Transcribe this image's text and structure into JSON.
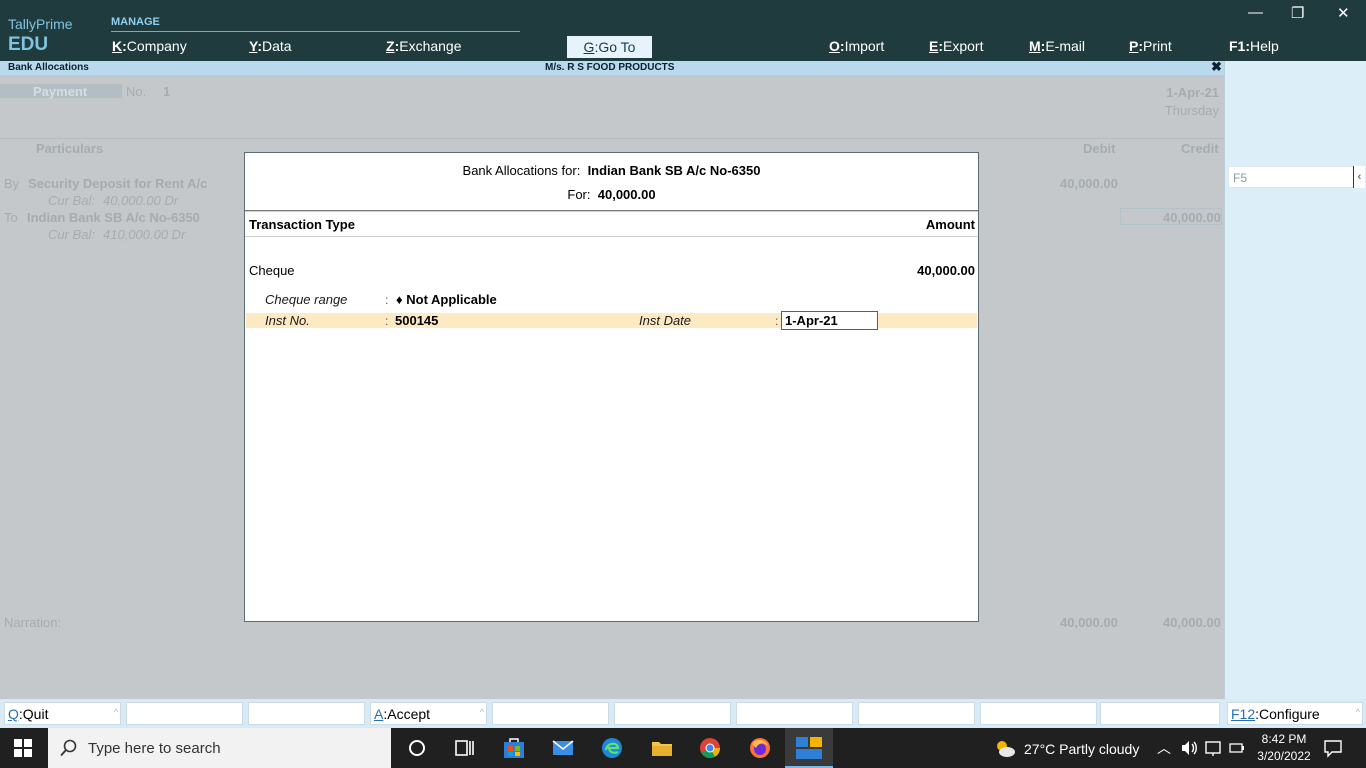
{
  "app": {
    "brand_line1": "TallyPrime",
    "brand_line2": "EDU",
    "manage_label": "MANAGE"
  },
  "menu": {
    "company": {
      "key": "K",
      "label": "Company"
    },
    "data": {
      "key": "Y",
      "label": "Data"
    },
    "exchange": {
      "key": "Z",
      "label": "Exchange"
    },
    "goto": {
      "key": "G",
      "label": "Go To"
    },
    "import": {
      "key": "O",
      "label": "Import"
    },
    "export": {
      "key": "E",
      "label": "Export"
    },
    "email": {
      "key": "M",
      "label": "E-mail"
    },
    "print": {
      "key": "P",
      "label": "Print"
    },
    "help": {
      "key": "F1",
      "label": "Help"
    }
  },
  "window_controls": {
    "minimize": "—",
    "restore": "❐",
    "close": "✕"
  },
  "subbar": {
    "title": "Bank Allocations",
    "company": "M/s. R S FOOD PRODUCTS",
    "close": "✖"
  },
  "voucher": {
    "type": "Payment",
    "no_label": "No.",
    "no_value": "1",
    "date": "1-Apr-21",
    "day": "Thursday",
    "col_particulars": "Particulars",
    "col_debit": "Debit",
    "col_credit": "Credit",
    "row1": {
      "prefix": "By",
      "ledger": "Security Deposit for Rent A/c",
      "cur_bal_label": "Cur Bal:",
      "cur_bal": "40,000.00 Dr",
      "debit": "40,000.00"
    },
    "row2": {
      "prefix": "To",
      "ledger": "Indian Bank SB A/c No-6350",
      "cur_bal_label": "Cur Bal:",
      "cur_bal": "410,000.00 Dr",
      "credit": "40,000.00"
    },
    "narration_label": "Narration:",
    "total_debit": "40,000.00",
    "total_credit": "40,000.00"
  },
  "right_panel": {
    "f5_placeholder": "F5",
    "arrow": "‹"
  },
  "dialog": {
    "title_prefix": "Bank Allocations for:",
    "title_ledger": "Indian Bank SB A/c No-6350",
    "for_label": "For:",
    "for_amount": "40,000.00",
    "col_type": "Transaction Type",
    "col_amount": "Amount",
    "txn_type": "Cheque",
    "txn_amount": "40,000.00",
    "cheque_range_label": "Cheque range",
    "cheque_range_value": "♦ Not Applicable",
    "inst_no_label": "Inst No.",
    "inst_no_value": "500145",
    "inst_date_label": "Inst Date",
    "inst_date_value": "1-Apr-21",
    "colon": ":"
  },
  "buttons": {
    "quit": {
      "key": "Q",
      "label": "Quit"
    },
    "accept": {
      "key": "A",
      "label": "Accept"
    },
    "configure": {
      "key": "F12",
      "label": "Configure"
    }
  },
  "taskbar": {
    "search_placeholder": "Type here to search",
    "weather": "27°C  Partly cloudy",
    "time": "8:42 PM",
    "date": "3/20/2022"
  },
  "colors": {
    "header_bg": "#1f3b3d",
    "accent_blue": "#2a6fb4",
    "highlight_row": "#fde9c2"
  }
}
